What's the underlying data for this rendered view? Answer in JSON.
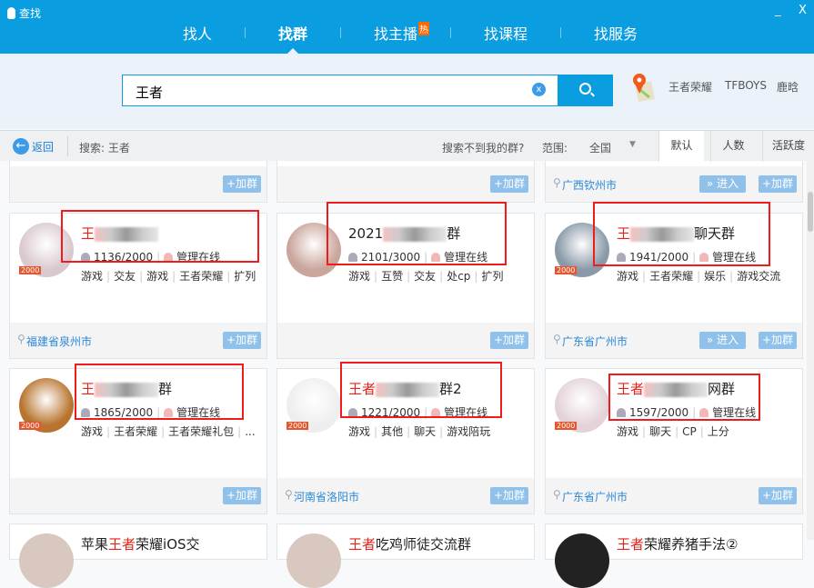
{
  "window": {
    "title": "查找",
    "minimize": "_",
    "close": "X"
  },
  "tabs": [
    {
      "label": "找人"
    },
    {
      "label": "找群",
      "active": true
    },
    {
      "label": "找主播",
      "badge": "热"
    },
    {
      "label": "找课程"
    },
    {
      "label": "找服务"
    }
  ],
  "search": {
    "value": "王者",
    "clear": "x",
    "hot_words": [
      "王者荣耀",
      "TFBOYS",
      "鹿晗"
    ]
  },
  "filter": {
    "back": "返回",
    "query": "搜索: 王者",
    "not_found": "搜索不到我的群?",
    "range_label": "范围:",
    "range_value": "全国",
    "sort": [
      "默认",
      "人数",
      "活跃度"
    ]
  },
  "buttons": {
    "join": "+加群",
    "enter": "» 进入"
  },
  "colors": {
    "brand": "#0a9de0",
    "highlight": "#e5231a",
    "annotation": "#f21b1b"
  },
  "partial_row": [
    {
      "location": "",
      "enter": false
    },
    {
      "location": "",
      "enter": false
    },
    {
      "location": "广西钦州市",
      "enter": true
    }
  ],
  "cards": [
    {
      "prefix": "王",
      "suffix": "",
      "members": "1136/2000",
      "admin": "管理在线",
      "badge": "2000",
      "tags": [
        "游戏",
        "交友",
        "游戏",
        "王者荣耀",
        "扩列"
      ],
      "location": "福建省泉州市",
      "enter": false,
      "avatar": "#d9c9cf"
    },
    {
      "prefix": "",
      "plain": "2021",
      "suffix": "群",
      "members": "2101/3000",
      "admin": "管理在线",
      "badge": "",
      "tags": [
        "游戏",
        "互赞",
        "交友",
        "处cp",
        "扩列"
      ],
      "location": "",
      "enter": false,
      "avatar": "#c9a59b"
    },
    {
      "prefix": "王",
      "suffix": "聊天群",
      "members": "1941/2000",
      "admin": "管理在线",
      "badge": "2000",
      "tags": [
        "游戏",
        "王者荣耀",
        "娱乐",
        "游戏交流"
      ],
      "location": "广东省广州市",
      "enter": true,
      "avatar": "#8a99a8"
    },
    {
      "prefix": "王",
      "suffix": "群",
      "members": "1865/2000",
      "admin": "管理在线",
      "badge": "2000",
      "tags": [
        "游戏",
        "王者荣耀",
        "王者荣耀礼包",
        "..."
      ],
      "location": "",
      "enter": false,
      "avatar": "#b8742e"
    },
    {
      "prefix": "王者",
      "suffix": "群2",
      "members": "1221/2000",
      "admin": "管理在线",
      "badge": "2000",
      "tags": [
        "游戏",
        "其他",
        "聊天",
        "游戏陪玩"
      ],
      "location": "河南省洛阳市",
      "enter": false,
      "avatar": "#eeeeee"
    },
    {
      "prefix": "王者",
      "suffix": "网群",
      "members": "1597/2000",
      "admin": "管理在线",
      "badge": "2000",
      "tags": [
        "游戏",
        "聊天",
        "CP",
        "上分"
      ],
      "location": "广东省广州市",
      "enter": false,
      "avatar": "#e3d3d8"
    }
  ],
  "bottom_row": [
    {
      "pre": "苹果",
      "hl": "王者",
      "post": "荣耀iOS交"
    },
    {
      "pre": "",
      "hl": "王者",
      "post": "吃鸡师徒交流群"
    },
    {
      "pre": "",
      "hl": "王者",
      "post": "荣耀养猪手法②"
    }
  ]
}
